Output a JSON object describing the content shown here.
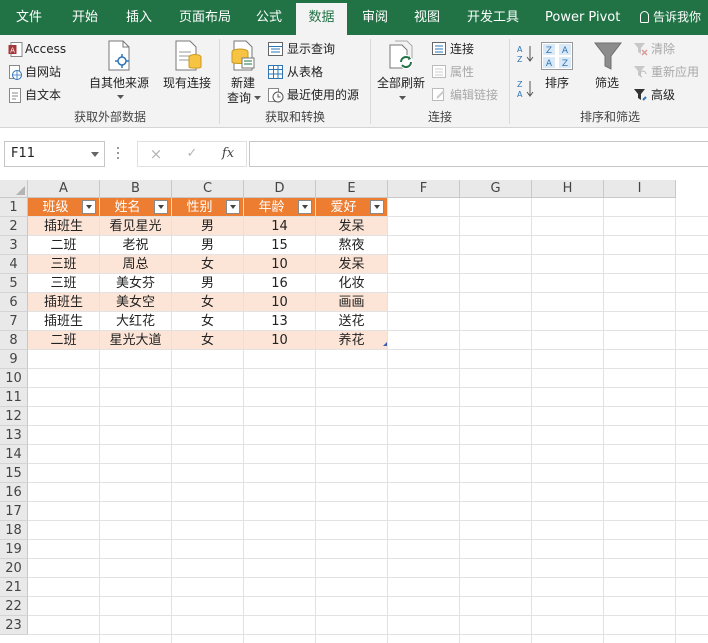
{
  "tabs": [
    {
      "label": "文件"
    },
    {
      "label": "开始"
    },
    {
      "label": "插入"
    },
    {
      "label": "页面布局"
    },
    {
      "label": "公式"
    },
    {
      "label": "数据",
      "active": true
    },
    {
      "label": "审阅"
    },
    {
      "label": "视图"
    },
    {
      "label": "开发工具"
    },
    {
      "label": "Power Pivot"
    }
  ],
  "tell_me": "告诉我你",
  "ribbon": {
    "get_external": {
      "access": "Access",
      "web": "自网站",
      "text": "自文本",
      "other_sources": "自其他来源",
      "existing": "现有连接",
      "label": "获取外部数据"
    },
    "get_transform": {
      "new_query_line1": "新建",
      "new_query_line2": "查询",
      "show_queries": "显示查询",
      "from_table": "从表格",
      "recent_sources": "最近使用的源",
      "label": "获取和转换"
    },
    "connections": {
      "refresh_all": "全部刷新",
      "connections": "连接",
      "properties": "属性",
      "edit_links": "编辑链接",
      "label": "连接"
    },
    "sort_filter": {
      "sort": "排序",
      "filter": "筛选",
      "clear": "清除",
      "reapply": "重新应用",
      "advanced": "高级",
      "label": "排序和筛选"
    }
  },
  "formula_bar": {
    "name_box": "F11",
    "fx": "fx",
    "cancel_icon": "×",
    "enter_icon": "✓",
    "formula": ""
  },
  "columns": [
    "A",
    "B",
    "C",
    "D",
    "E",
    "F",
    "G",
    "H",
    "I"
  ],
  "rows": [
    "1",
    "2",
    "3",
    "4",
    "5",
    "6",
    "7",
    "8",
    "9",
    "10",
    "11",
    "12",
    "13",
    "14",
    "15",
    "16",
    "17",
    "18",
    "19",
    "20",
    "21",
    "22",
    "23"
  ],
  "table": {
    "headers": [
      "班级",
      "姓名",
      "性别",
      "年龄",
      "爱好"
    ],
    "rows": [
      [
        "插班生",
        "看见星光",
        "男",
        "14",
        "发呆"
      ],
      [
        "二班",
        "老祝",
        "男",
        "15",
        "熬夜"
      ],
      [
        "三班",
        "周总",
        "女",
        "10",
        "发呆"
      ],
      [
        "三班",
        "美女芬",
        "男",
        "16",
        "化妆"
      ],
      [
        "插班生",
        "美女空",
        "女",
        "10",
        "画画"
      ],
      [
        "插班生",
        "大红花",
        "女",
        "13",
        "送花"
      ],
      [
        "二班",
        "星光大道",
        "女",
        "10",
        "养花"
      ]
    ]
  },
  "colors": {
    "brand": "#217346",
    "table_header": "#ed7d31",
    "band_light": "#fce4d6",
    "band_white": "#ffffff"
  }
}
